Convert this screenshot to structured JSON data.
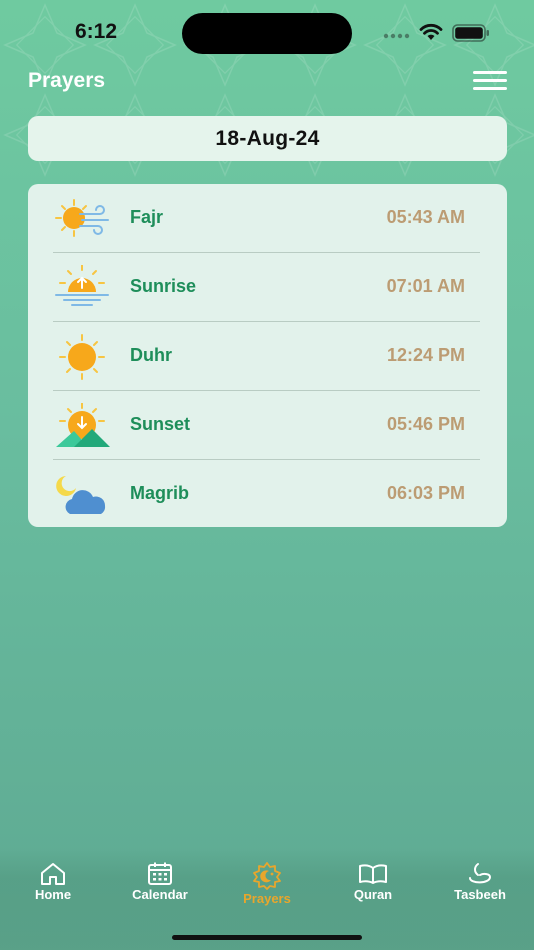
{
  "status_bar": {
    "time": "6:12"
  },
  "header": {
    "title": "Prayers"
  },
  "date": "18-Aug-24",
  "prayers": [
    {
      "name": "Fajr",
      "time": "05:43 AM",
      "icon": "sun-wind-icon"
    },
    {
      "name": "Sunrise",
      "time": "07:01 AM",
      "icon": "sunrise-icon"
    },
    {
      "name": "Duhr",
      "time": "12:24 PM",
      "icon": "sun-icon"
    },
    {
      "name": "Sunset",
      "time": "05:46 PM",
      "icon": "sunset-icon"
    },
    {
      "name": "Magrib",
      "time": "06:03 PM",
      "icon": "moon-cloud-icon"
    }
  ],
  "tabs": [
    {
      "label": "Home",
      "icon": "home-icon",
      "active": false
    },
    {
      "label": "Calendar",
      "icon": "calendar-icon",
      "active": false
    },
    {
      "label": "Prayers",
      "icon": "mosque-icon",
      "active": true
    },
    {
      "label": "Quran",
      "icon": "book-icon",
      "active": false
    },
    {
      "label": "Tasbeeh",
      "icon": "tasbeeh-icon",
      "active": false
    }
  ],
  "colors": {
    "accent_green": "#1e8e5a",
    "time_gold": "#bc9c73",
    "active_tab": "#e8a62c",
    "card_bg": "#e2f2eb"
  }
}
